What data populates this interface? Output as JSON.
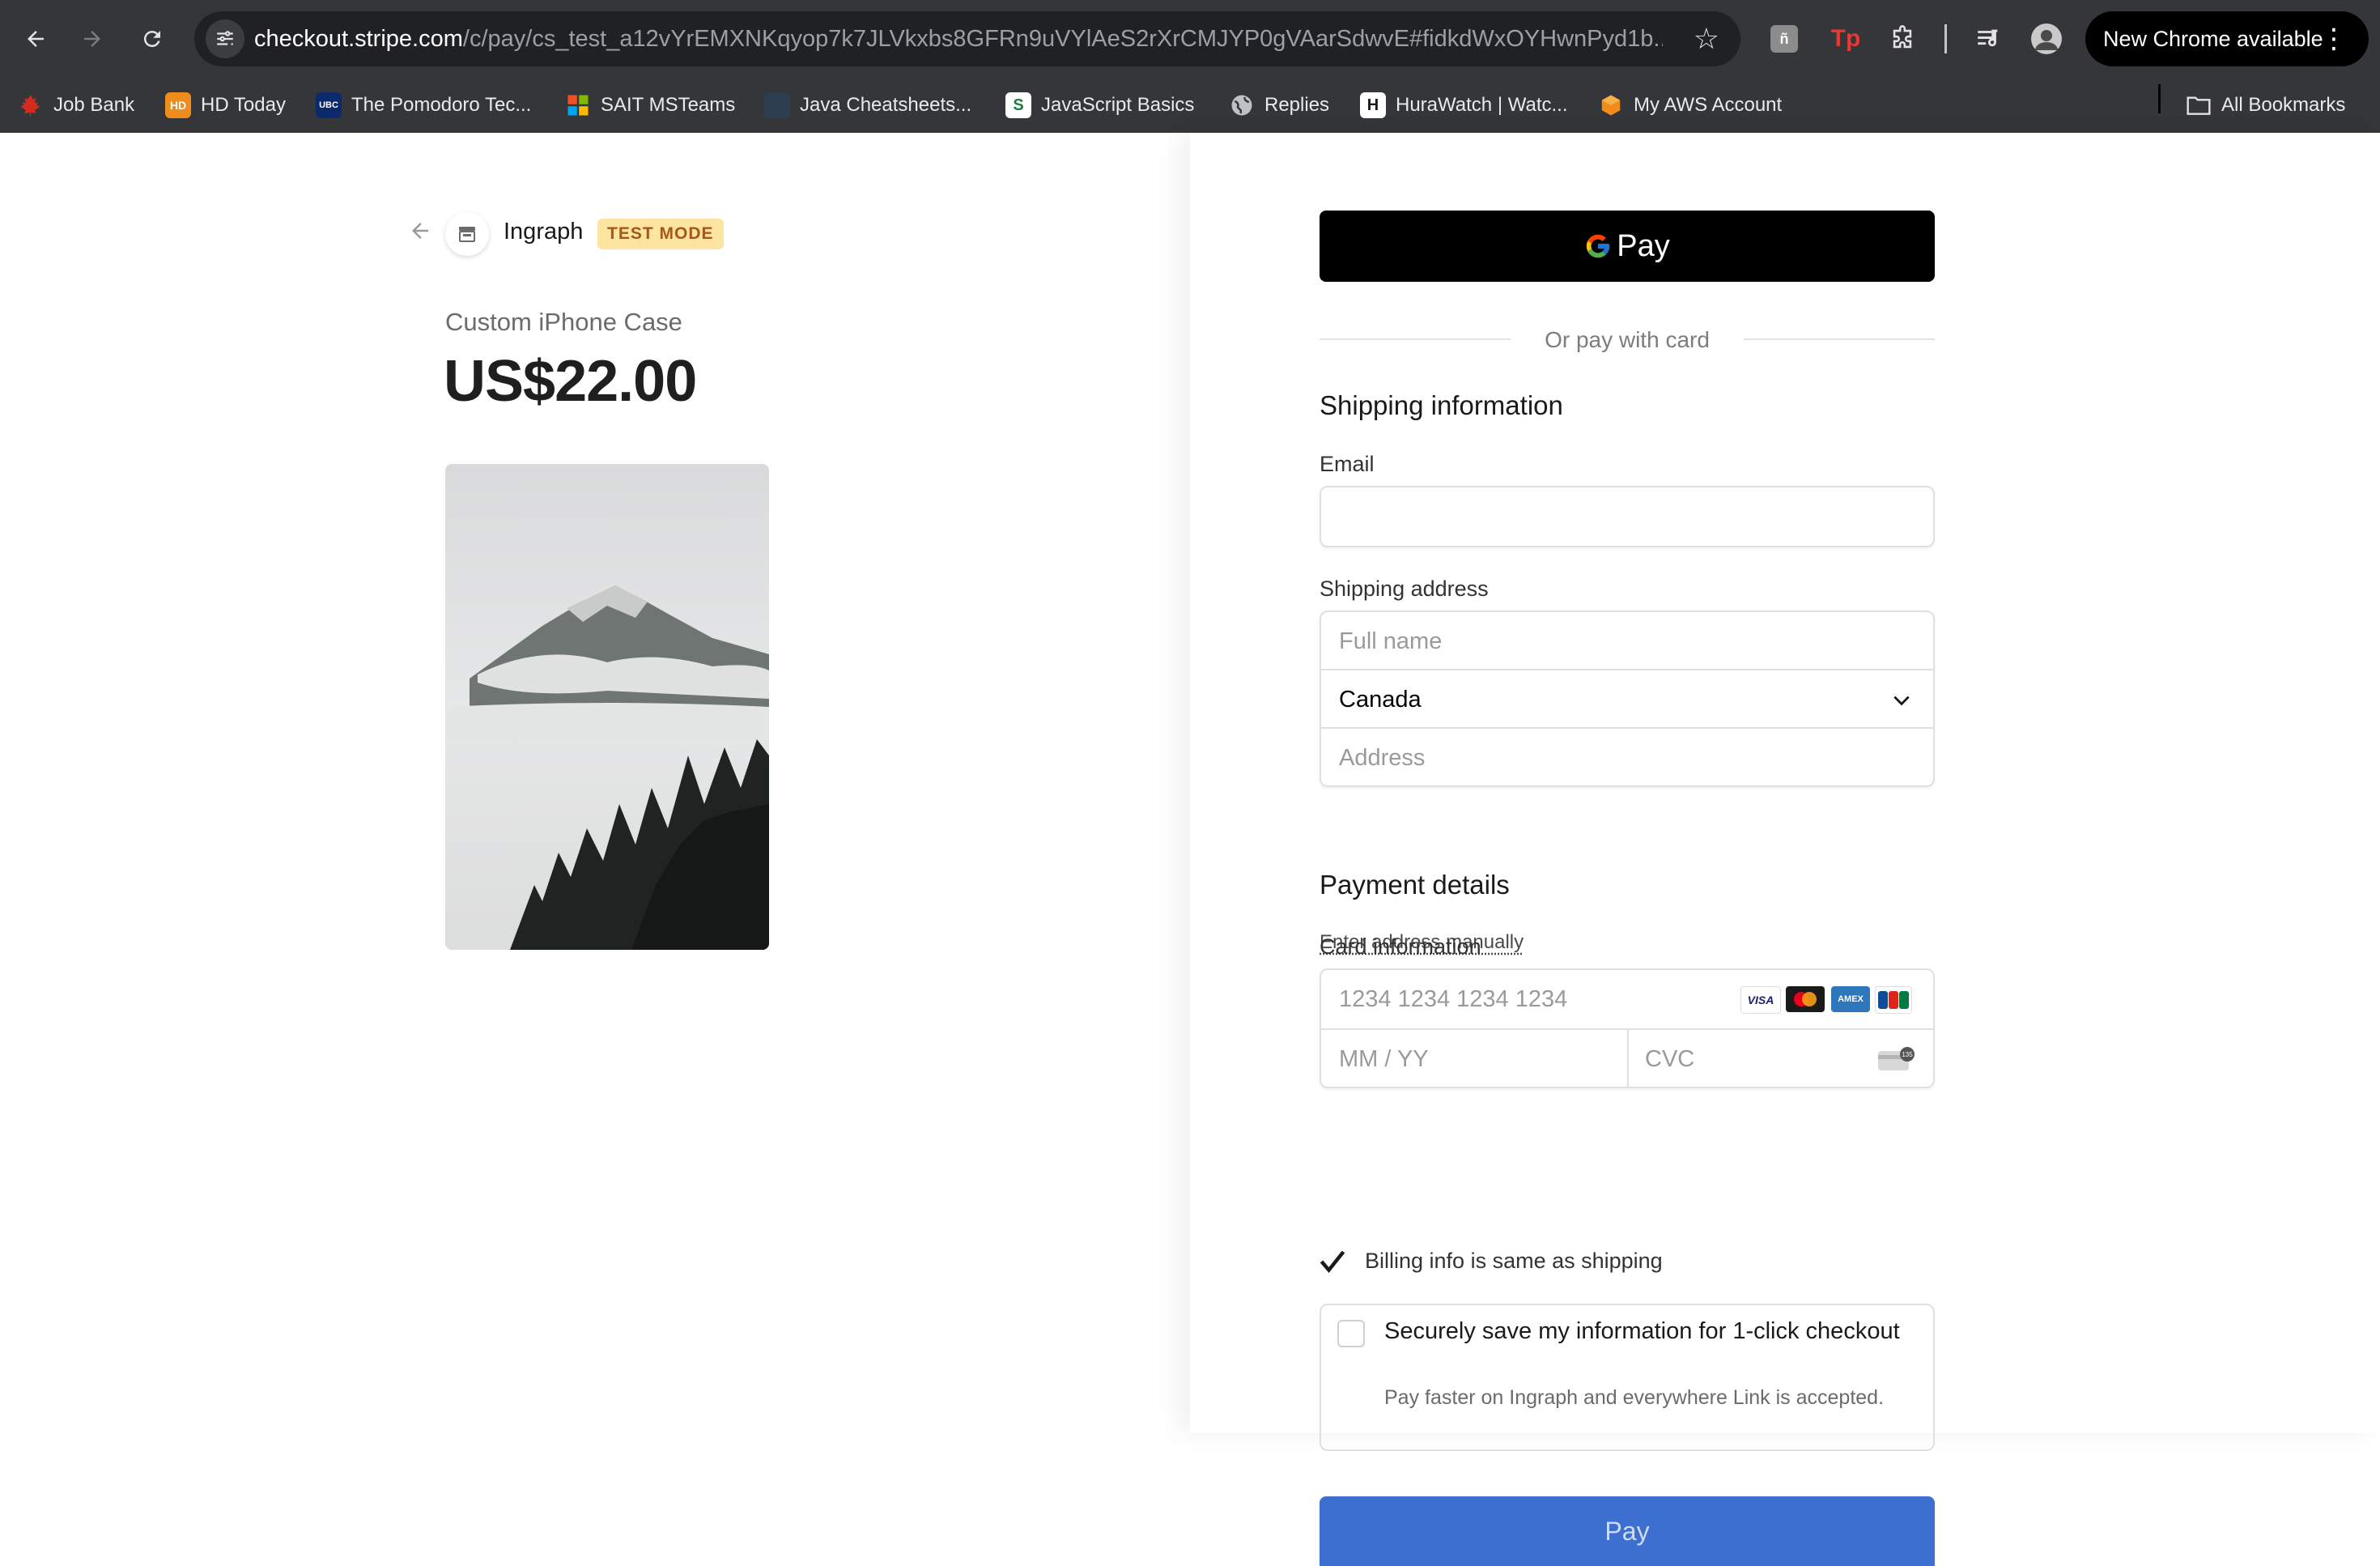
{
  "browser": {
    "url_host": "checkout.stripe.com",
    "url_rest": "/c/pay/cs_test_a12vYrEMXNKqyop7k7JLVkxbs8GFRn9uVYlAeS2rXrCMJYP0gVAarSdwvE#fidkdWxOYHwnPyd1b...",
    "new_chrome_label": "New Chrome available",
    "bookmarks": [
      {
        "label": "Job Bank",
        "icon": "maple-leaf-icon"
      },
      {
        "label": "HD Today",
        "icon": "hd-icon"
      },
      {
        "label": "The Pomodoro Tec...",
        "icon": "ubc-icon"
      },
      {
        "label": "SAIT MSTeams",
        "icon": "microsoft-icon"
      },
      {
        "label": "Java Cheatsheets...",
        "icon": "page-icon"
      },
      {
        "label": "JavaScript Basics",
        "icon": "s-icon"
      },
      {
        "label": "Replies",
        "icon": "globe-icon"
      },
      {
        "label": "HuraWatch | Watc...",
        "icon": "h-icon"
      },
      {
        "label": "My AWS Account",
        "icon": "aws-icon"
      }
    ],
    "all_bookmarks_label": "All Bookmarks"
  },
  "summary": {
    "merchant": "Ingraph",
    "badge": "TEST MODE",
    "product_name": "Custom iPhone Case",
    "price": "US$22.00"
  },
  "checkout": {
    "gpay_label": "Pay",
    "or_text": "Or pay with card",
    "shipping_title": "Shipping information",
    "email_label": "Email",
    "email_value": "",
    "address_label": "Shipping address",
    "fullname_placeholder": "Full name",
    "country": "Canada",
    "address_placeholder": "Address",
    "manual_link": "Enter address manually",
    "payment_title": "Payment details",
    "card_label": "Card information",
    "card_placeholder": "1234 1234 1234 1234",
    "expiry_placeholder": "MM / YY",
    "cvc_placeholder": "CVC",
    "billing_same_label": "Billing info is same as shipping",
    "billing_same_checked": true,
    "save_title": "Securely save my information for 1-click checkout",
    "save_desc": "Pay faster on Ingraph and everywhere Link is accepted.",
    "pay_button": "Pay"
  },
  "colors": {
    "accent": "#3d6fd1",
    "badge_bg": "#fde4a0",
    "badge_text": "#a2591a",
    "chrome_bg": "#35363a"
  }
}
